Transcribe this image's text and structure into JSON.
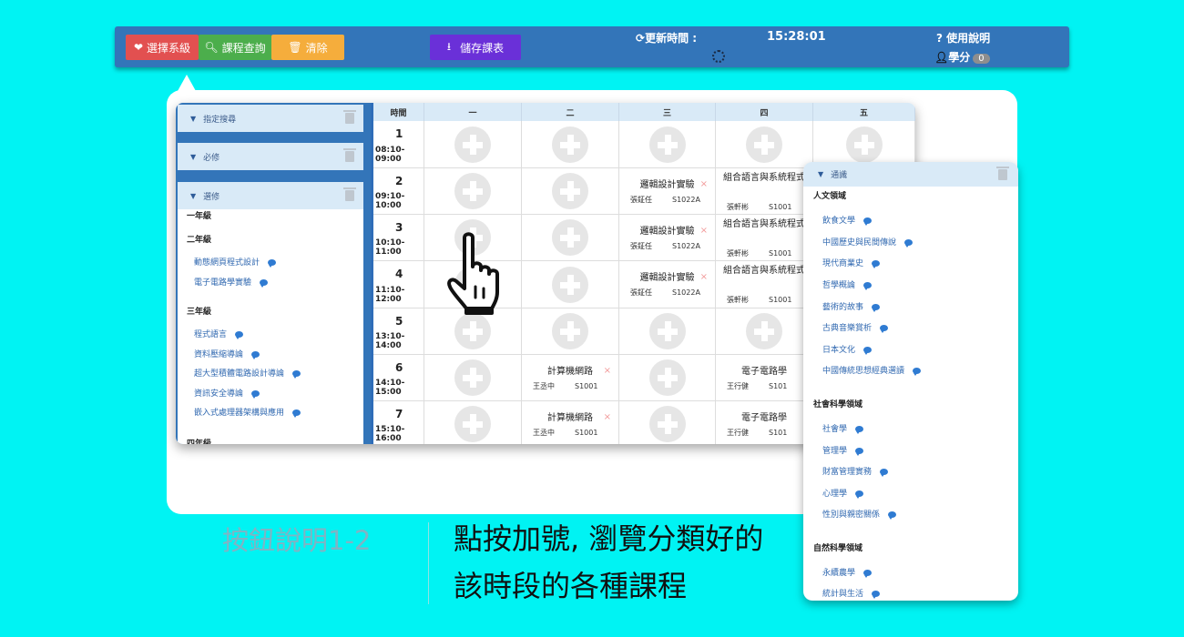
{
  "navbar": {
    "select_department": "選擇系級",
    "course_query": "課程查詢",
    "clear": "清除",
    "save_timetable": "儲存課表",
    "update_time_label": "更新時間 :",
    "update_time": "15:28:01",
    "help": "? 使用說明",
    "credits_label": "學分",
    "credits_value": "0"
  },
  "sidebar": {
    "sections": [
      "指定搜尋",
      "必修",
      "選修"
    ],
    "elective": {
      "grade1": "一年級",
      "grade2": "二年級",
      "grade2_courses": [
        "動態網頁程式設計",
        "電子電路學實驗"
      ],
      "grade3": "三年級",
      "grade3_courses": [
        "程式語言",
        "資料壓縮導論",
        "超大型積體電路設計導論",
        "資訊安全導論",
        "嵌入式處理器架構與應用"
      ],
      "grade4": "四年級"
    }
  },
  "timetable": {
    "headers": [
      "時間",
      "一",
      "二",
      "三",
      "四",
      "五"
    ],
    "periods": [
      {
        "num": "1",
        "time": "08:10-09:00"
      },
      {
        "num": "2",
        "time": "09:10-10:00"
      },
      {
        "num": "3",
        "time": "10:10-11:00"
      },
      {
        "num": "4",
        "time": "11:10-12:00"
      },
      {
        "num": "5",
        "time": "13:10-14:00"
      },
      {
        "num": "6",
        "time": "14:10-15:00"
      },
      {
        "num": "7",
        "time": "15:10-16:00"
      }
    ],
    "courses": {
      "logic_lab": {
        "name": "邏輯設計實驗",
        "teacher": "張鉦任",
        "room": "S1022A"
      },
      "assembly": {
        "name": "組合語言與系統程式",
        "teacher": "張軒彬",
        "room": "S1001"
      },
      "network": {
        "name": "計算機網路",
        "teacher": "王丞中",
        "room": "S1001"
      },
      "circuits": {
        "name": "電子電路學",
        "teacher": "王行健",
        "room": "S101"
      }
    },
    "delete_mark": "×"
  },
  "general_ed": {
    "title": "通識",
    "domain_humanities": "人文領域",
    "humanities": [
      "飲食文學",
      "中國歷史與民間傳說",
      "現代商業史",
      "哲學概論",
      "藝術的故事",
      "古典音樂賞析",
      "日本文化",
      "中國傳統思想經典選讀"
    ],
    "domain_social": "社會科學領域",
    "social": [
      "社會學",
      "管理學",
      "財富管理實務",
      "心理學",
      "性別與親密關係"
    ],
    "domain_natural": "自然科學領域",
    "natural": [
      "永續農學",
      "統計與生活"
    ]
  },
  "caption": {
    "label": "按鈕說明1-2",
    "line1": "點按加號, 瀏覽分類好的",
    "line2": "該時段的各種課程"
  },
  "colors": {
    "background": "#00f3f3",
    "navbar": "#3375b9",
    "select_button": "#e25050",
    "query_button": "#4cae4c",
    "clear_button": "#f5ad3c",
    "save_button": "#6a30d8",
    "link_text": "#3068b0"
  },
  "icons": [
    "heart-icon",
    "search-icon",
    "trash-icon",
    "download-icon",
    "refresh-icon",
    "user-icon",
    "plus-circle-icon",
    "comment-icon",
    "hand-pointer-icon",
    "caret-down-icon"
  ]
}
